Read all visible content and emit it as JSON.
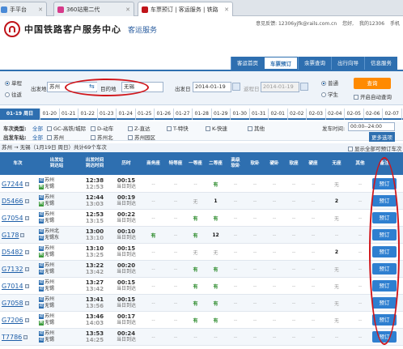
{
  "browser_tabs": [
    {
      "label": "手平台",
      "color": "#4a8ad6"
    },
    {
      "label": "360站需二代",
      "color": "#d63a8a"
    },
    {
      "label": "车票预订 | 客运服务 | 铁路",
      "color": "#c0141a"
    }
  ],
  "header": {
    "brand": "中国铁路客户服务中心",
    "sub": "客运服务",
    "links": [
      "意见反馈: 12306yjfk@rails.com.cn",
      "您好, ",
      "我的12306",
      "手机"
    ]
  },
  "nav": [
    "客运首页",
    "车票预订",
    "余票查询",
    "出行向导",
    "信息服务"
  ],
  "search": {
    "trip_types": [
      "单程",
      "往返"
    ],
    "from_label": "出发地",
    "from_value": "苏州",
    "to_label": "目的地",
    "to_value": "无锡",
    "date_label": "出发日",
    "date_value": "2014-01-19",
    "return_label": "返程日",
    "return_value": "2014-01-19",
    "passenger_types": [
      "普通",
      "学生"
    ],
    "query_button": "查询",
    "auto_query": "开启自动查询"
  },
  "date_strip": [
    "01-19 周日",
    "01-20",
    "01-21",
    "01-22",
    "01-23",
    "01-24",
    "01-25",
    "01-26",
    "01-27",
    "01-28",
    "01-29",
    "01-30",
    "01-31",
    "02-01",
    "02-02",
    "02-03",
    "02-04",
    "02-05",
    "02-06",
    "02-07"
  ],
  "filters": {
    "train_type_label": "车次类型:",
    "all_label": "全部",
    "train_types": [
      "GC-高铁/城际",
      "D-动车",
      "Z-直达",
      "T-特快",
      "K-快速",
      "其他"
    ],
    "depart_station_label": "出发车站:",
    "stations": [
      "苏州",
      "苏州北",
      "苏州园区"
    ],
    "depart_time_label": "发车时间:",
    "depart_time_value": "00:00--24:00",
    "more": "更多选项"
  },
  "summary": {
    "text": "苏州 → 无锡（1月19日 周日）共计69个车次",
    "show_all": "显示全部可预订车次"
  },
  "columns": [
    "车次",
    "出发站\n到达站",
    "出发时间\n到达时间",
    "历时",
    "商务座",
    "特等座",
    "一等座",
    "二等座",
    "高级\n软卧",
    "软卧",
    "硬卧",
    "软座",
    "硬座",
    "无座",
    "其他",
    "备注"
  ],
  "trains": [
    {
      "code": "G7244",
      "from": "苏州",
      "to": "无锡",
      "fb": "pass",
      "tb": "end",
      "dep": "12:38",
      "arr": "12:53",
      "dur": "00:15",
      "day": "当日到达",
      "seats": [
        "--",
        "--",
        "--",
        "有",
        "--",
        "--",
        "--",
        "--",
        "--",
        "无",
        "--"
      ],
      "book": "预订"
    },
    {
      "code": "D5466",
      "from": "苏州",
      "to": "无锡",
      "fb": "pass",
      "tb": "end",
      "dep": "12:44",
      "arr": "13:03",
      "dur": "00:19",
      "day": "当日到达",
      "seats": [
        "--",
        "--",
        "无",
        "1",
        "--",
        "--",
        "--",
        "--",
        "--",
        "2",
        "--"
      ],
      "book": "预订"
    },
    {
      "code": "G7054",
      "from": "苏州",
      "to": "无锡",
      "fb": "pass",
      "tb": "pass",
      "dep": "12:53",
      "arr": "13:15",
      "dur": "00:22",
      "day": "当日到达",
      "seats": [
        "--",
        "--",
        "有",
        "有",
        "--",
        "--",
        "--",
        "--",
        "--",
        "无",
        "--"
      ],
      "book": "预订"
    },
    {
      "code": "G178",
      "from": "苏州北",
      "to": "无锡东",
      "fb": "pass",
      "tb": "pass",
      "dep": "13:00",
      "arr": "13:10",
      "dur": "00:10",
      "day": "当日到达",
      "seats": [
        "有",
        "--",
        "有",
        "12",
        "--",
        "--",
        "--",
        "--",
        "--",
        "--",
        "--"
      ],
      "book": "预订"
    },
    {
      "code": "D5482",
      "from": "苏州",
      "to": "无锡",
      "fb": "pass",
      "tb": "end",
      "dep": "13:10",
      "arr": "13:25",
      "dur": "00:15",
      "day": "当日到达",
      "seats": [
        "--",
        "--",
        "无",
        "无",
        "--",
        "--",
        "--",
        "--",
        "--",
        "2",
        "--"
      ],
      "book": "预订"
    },
    {
      "code": "G7132",
      "from": "苏州",
      "to": "无锡",
      "fb": "pass",
      "tb": "pass",
      "dep": "13:22",
      "arr": "13:42",
      "dur": "00:20",
      "day": "当日到达",
      "seats": [
        "--",
        "--",
        "有",
        "有",
        "--",
        "--",
        "--",
        "--",
        "--",
        "无",
        "--"
      ],
      "book": "预订"
    },
    {
      "code": "G7014",
      "from": "苏州",
      "to": "无锡",
      "fb": "pass",
      "tb": "pass",
      "dep": "13:27",
      "arr": "13:42",
      "dur": "00:15",
      "day": "当日到达",
      "seats": [
        "--",
        "--",
        "有",
        "有",
        "--",
        "--",
        "--",
        "--",
        "--",
        "无",
        "--"
      ],
      "book": "预订"
    },
    {
      "code": "G7058",
      "from": "苏州",
      "to": "无锡",
      "fb": "pass",
      "tb": "pass",
      "dep": "13:41",
      "arr": "13:56",
      "dur": "00:15",
      "day": "当日到达",
      "seats": [
        "--",
        "--",
        "有",
        "有",
        "--",
        "--",
        "--",
        "--",
        "--",
        "无",
        "--"
      ],
      "book": "预订"
    },
    {
      "code": "G7206",
      "from": "苏州",
      "to": "无锡",
      "fb": "pass",
      "tb": "end",
      "dep": "13:46",
      "arr": "14:03",
      "dur": "00:17",
      "day": "当日到达",
      "seats": [
        "--",
        "--",
        "有",
        "有",
        "--",
        "--",
        "--",
        "--",
        "--",
        "无",
        "--"
      ],
      "book": "预订"
    },
    {
      "code": "T7786",
      "from": "苏州",
      "to": "无锡",
      "fb": "pass",
      "tb": "pass",
      "dep": "13:53",
      "arr": "14:25",
      "dur": "00:24",
      "day": "当日到达",
      "seats": [
        "--",
        "--",
        "--",
        "--",
        "--",
        "--",
        "--",
        "--",
        "--",
        "--",
        "--"
      ],
      "book": "预订"
    }
  ],
  "colors": {
    "brand_red": "#c0141a",
    "nav_blue": "#2e6fb0",
    "query_orange": "#ff8a00",
    "annotation_red": "#d0151a"
  },
  "icons": [
    "railway-logo-icon",
    "swap-stations-icon",
    "calendar-icon",
    "tab-favicon-icon"
  ]
}
